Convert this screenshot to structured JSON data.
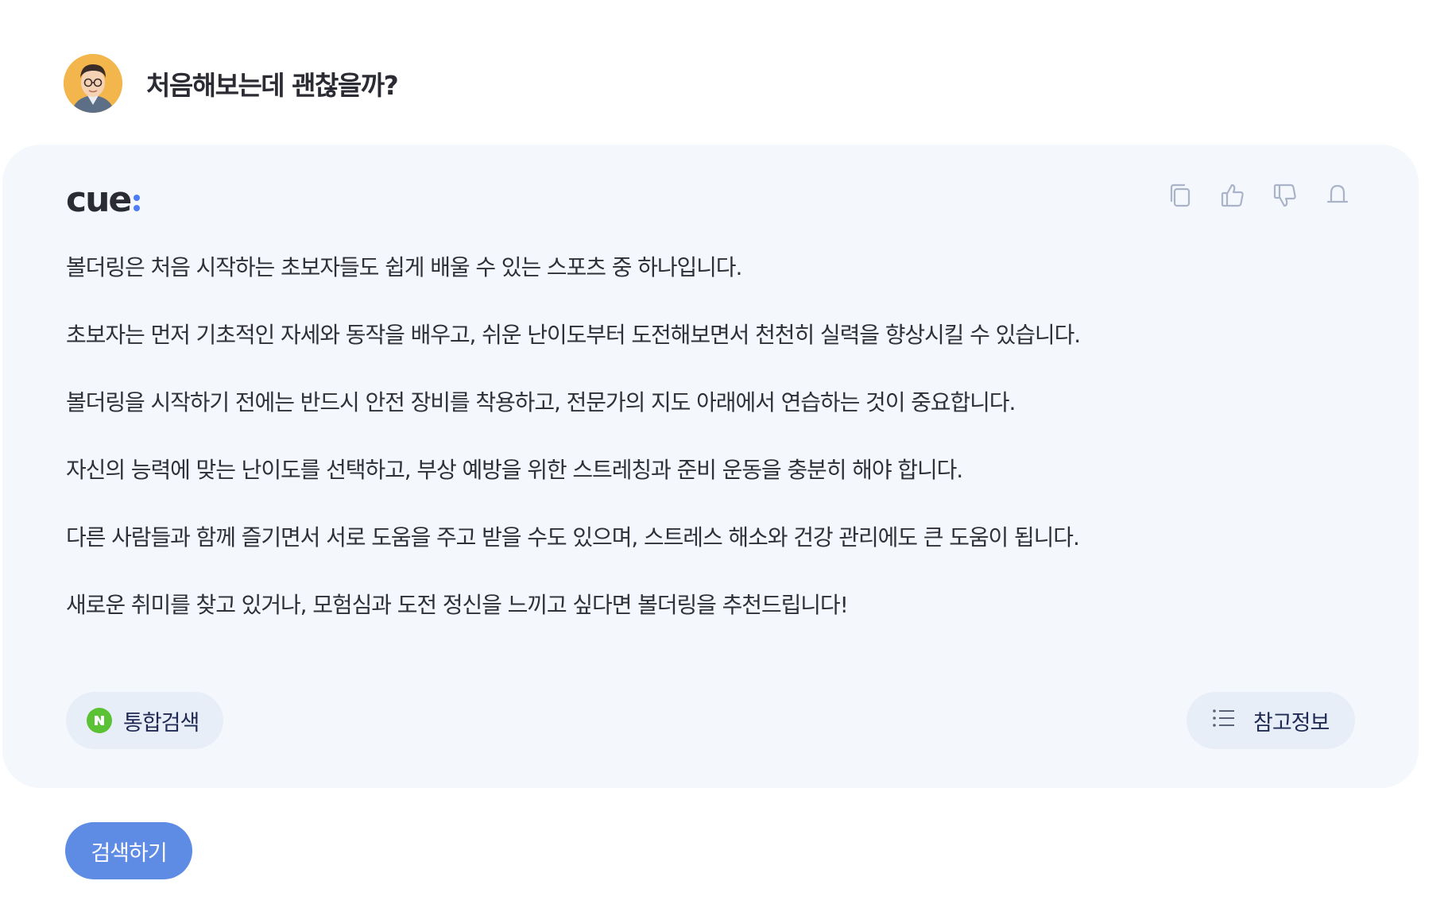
{
  "question": {
    "avatar_icon": "user-avatar-icon",
    "text": "처음해보는데 괜찮을까?"
  },
  "answer": {
    "brand": {
      "name": "cue",
      "dot_color": "#4e7cf5"
    },
    "actions": [
      {
        "icon": "copy-icon"
      },
      {
        "icon": "thumbs-up-icon"
      },
      {
        "icon": "thumbs-down-icon"
      },
      {
        "icon": "bell-icon"
      }
    ],
    "paragraphs": [
      "볼더링은 처음 시작하는 초보자들도 쉽게 배울 수 있는 스포츠 중 하나입니다.",
      "초보자는 먼저 기초적인 자세와 동작을 배우고, 쉬운 난이도부터 도전해보면서 천천히 실력을 향상시킬 수 있습니다.",
      "볼더링을 시작하기 전에는 반드시 안전 장비를 착용하고, 전문가의 지도 아래에서 연습하는 것이 중요합니다.",
      "자신의 능력에 맞는 난이도를 선택하고, 부상 예방을 위한 스트레칭과 준비 운동을 충분히 해야 합니다.",
      "다른 사람들과 함께 즐기면서 서로 도움을 주고 받을 수도 있으며, 스트레스 해소와 건강 관리에도 큰 도움이 됩니다.",
      "새로운 취미를 찾고 있거나, 모험심과 도전 정신을 느끼고 싶다면 볼더링을 추천드립니다!"
    ],
    "integrated_search": {
      "icon": "naver-n-icon",
      "label": "통합검색",
      "icon_color": "#5bc236"
    },
    "references": {
      "icon": "list-icon",
      "label": "참고정보"
    }
  },
  "search_button": {
    "label": "검색하기",
    "color": "#5e8be4"
  },
  "colors": {
    "card_background": "#f4f7fc",
    "pill_background": "#e8eef8",
    "text": "#303038"
  }
}
